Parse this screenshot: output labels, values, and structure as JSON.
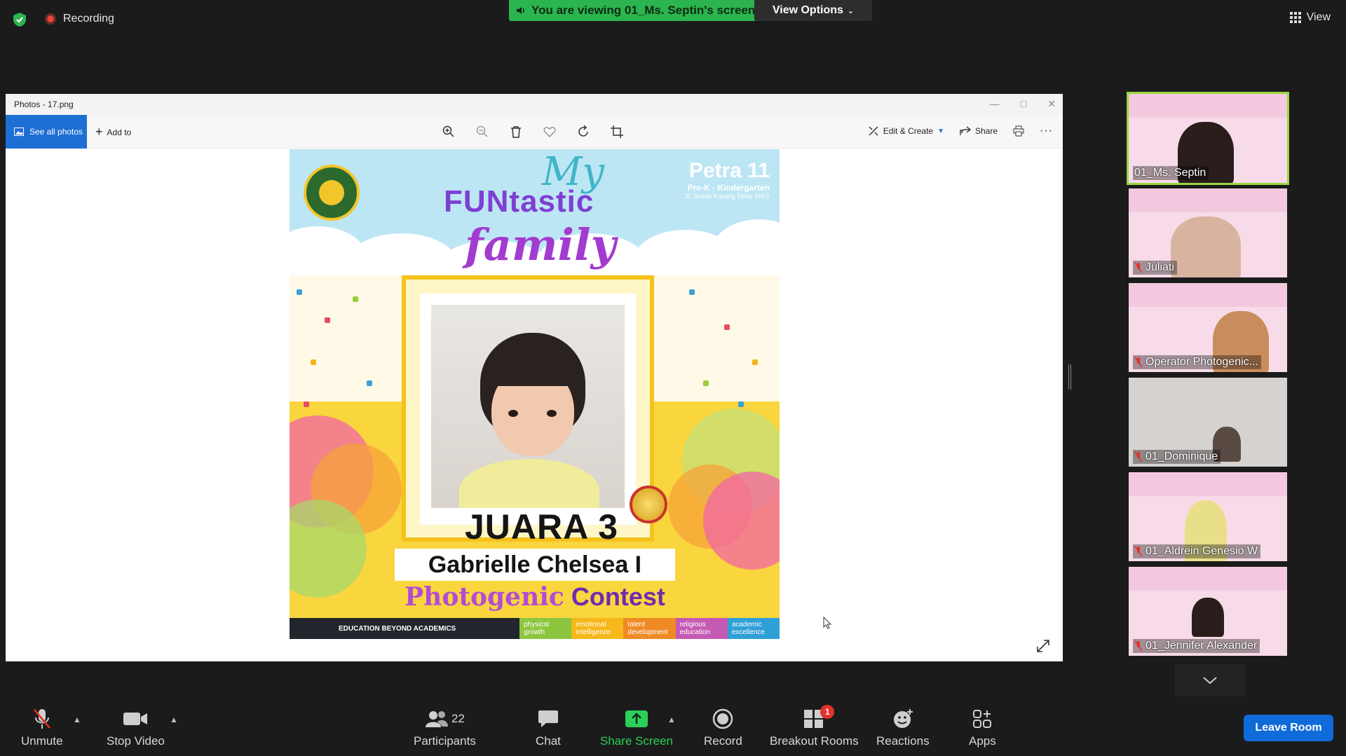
{
  "topbar": {
    "recording_label": "Recording",
    "viewing_text": "You are viewing 01_Ms. Septin's screen",
    "view_options_label": "View Options",
    "view_label": "View"
  },
  "photos_window": {
    "title": "Photos - 17.png",
    "see_all_label": "See all photos",
    "add_to_label": "Add to",
    "edit_create_label": "Edit & Create",
    "share_label": "Share",
    "tool_icons": [
      "zoom-in-icon",
      "zoom-out-icon",
      "delete-icon",
      "heart-icon",
      "rotate-icon",
      "crop-icon"
    ]
  },
  "poster": {
    "title_my": "My",
    "title_funtastic": "FUNtastic",
    "title_family": "family",
    "school_name": "Petra 11",
    "school_level": "Pre-K - Kindergarten",
    "school_address": "Jl. Dukuh Kupang Timur XIA/7",
    "award": "JUARA 3",
    "winner_name": "Gabrielle Chelsea I",
    "contest_word_1": "Photogenic",
    "contest_word_2": "Contest",
    "footer_edu": "EDUCATION BEYOND ACADEMICS",
    "footer_cells": [
      {
        "text": "physical growth",
        "color": "#8cc63f"
      },
      {
        "text": "emotional intelligence",
        "color": "#f6b81a"
      },
      {
        "text": "talent development",
        "color": "#f08a24"
      },
      {
        "text": "religious education",
        "color": "#c45ab3"
      },
      {
        "text": "academic excellence",
        "color": "#2f9fd8"
      }
    ]
  },
  "gallery": {
    "participants": [
      {
        "name": "01_Ms. Septin",
        "active": true,
        "muted": false
      },
      {
        "name": "Juliati",
        "active": false,
        "muted": true
      },
      {
        "name": "Operator Photogenic...",
        "active": false,
        "muted": true
      },
      {
        "name": "01_Dominique",
        "active": false,
        "muted": true
      },
      {
        "name": "01_Aldrein Genesio W",
        "active": false,
        "muted": true
      },
      {
        "name": "01_Jennifer Alexander",
        "active": false,
        "muted": true
      }
    ]
  },
  "bottombar": {
    "unmute_label": "Unmute",
    "stop_video_label": "Stop Video",
    "participants_label": "Participants",
    "participants_count": "22",
    "chat_label": "Chat",
    "share_screen_label": "Share Screen",
    "record_label": "Record",
    "breakout_rooms_label": "Breakout Rooms",
    "breakout_badge": "1",
    "reactions_label": "Reactions",
    "apps_label": "Apps",
    "leave_room_label": "Leave Room"
  },
  "colors": {
    "accent_green": "#2bb44f",
    "leave_blue": "#0e6bd8",
    "active_speaker": "#98d63f",
    "photos_blue": "#1e6fd4"
  }
}
